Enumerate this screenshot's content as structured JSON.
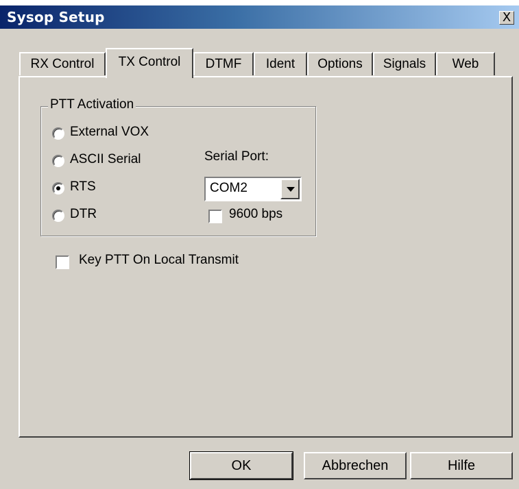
{
  "window": {
    "title": "Sysop Setup",
    "close_glyph": "X"
  },
  "tabs": [
    {
      "label": "RX Control"
    },
    {
      "label": "TX Control",
      "active": true
    },
    {
      "label": "DTMF"
    },
    {
      "label": "Ident"
    },
    {
      "label": "Options"
    },
    {
      "label": "Signals"
    },
    {
      "label": "Web"
    }
  ],
  "ptt": {
    "caption": "PTT Activation",
    "options": [
      {
        "label": "External VOX",
        "selected": false
      },
      {
        "label": "ASCII Serial",
        "selected": false
      },
      {
        "label": "RTS",
        "selected": true
      },
      {
        "label": "DTR",
        "selected": false
      }
    ],
    "serial_port_label": "Serial Port:",
    "serial_port_value": "COM2",
    "baud_label": "9600 bps",
    "baud_checked": false
  },
  "key_ptt": {
    "label": "Key PTT On Local Transmit",
    "checked": false
  },
  "buttons": {
    "ok": "OK",
    "cancel": "Abbrechen",
    "help": "Hilfe"
  },
  "icons": {
    "close": "close-icon",
    "dropdown": "chevron-down-icon"
  },
  "colors": {
    "face": "#d4d0c8",
    "title_start": "#0a246a",
    "title_end": "#a6caf0"
  }
}
